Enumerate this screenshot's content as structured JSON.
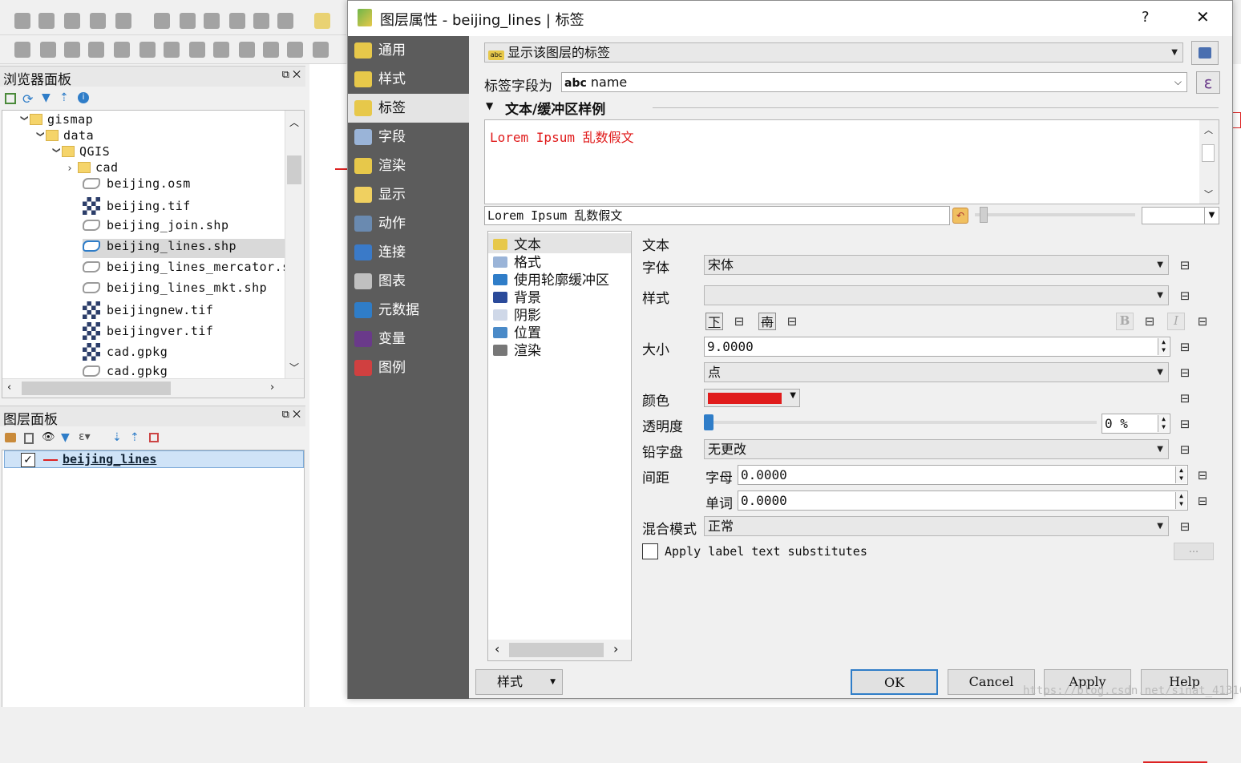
{
  "toolbar": {
    "rows": 2
  },
  "browser_panel": {
    "title": "浏览器面板",
    "items": [
      {
        "label": "gismap",
        "kind": "folder",
        "depth": 0,
        "expanded": true
      },
      {
        "label": "data",
        "kind": "folder",
        "depth": 1,
        "expanded": true
      },
      {
        "label": "QGIS",
        "kind": "folder",
        "depth": 2,
        "expanded": true
      },
      {
        "label": "cad",
        "kind": "folder",
        "depth": 3,
        "expanded": false
      },
      {
        "label": "beijing.osm",
        "kind": "vector"
      },
      {
        "label": "beijing.tif",
        "kind": "raster"
      },
      {
        "label": "beijing_join.shp",
        "kind": "vector"
      },
      {
        "label": "beijing_lines.shp",
        "kind": "vector",
        "selected": true
      },
      {
        "label": "beijing_lines_mercator.sh",
        "kind": "vector"
      },
      {
        "label": "beijing_lines_mkt.shp",
        "kind": "vector"
      },
      {
        "label": "beijingnew.tif",
        "kind": "raster"
      },
      {
        "label": "beijingver.tif",
        "kind": "raster"
      },
      {
        "label": "cad.gpkg",
        "kind": "raster"
      },
      {
        "label": "cad.gpkg",
        "kind": "vector"
      }
    ]
  },
  "layers_panel": {
    "title": "图层面板",
    "layer": "beijing_lines",
    "checked": true
  },
  "dialog": {
    "title": "图层属性 - beijing_lines | 标签",
    "help": "?",
    "close": "✕",
    "sidebar": [
      "通用",
      "样式",
      "标签",
      "字段",
      "渲染",
      "显示",
      "动作",
      "连接",
      "图表",
      "元数据",
      "变量",
      "图例"
    ],
    "sidebar_selected": 2,
    "mode_combo": "显示该图层的标签",
    "label_field_label": "标签字段为",
    "label_field_value": "name",
    "expr_symbol": "ε",
    "sample_section": "文本/缓冲区样例",
    "sample_text": "Lorem Ipsum 乱数假文",
    "sample_input": "Lorem Ipsum 乱数假文",
    "sub_tabs": [
      "文本",
      "格式",
      "使用轮廓缓冲区",
      "背景",
      "阴影",
      "位置",
      "渲染"
    ],
    "text_section": "文本",
    "font_label": "字体",
    "font_value": "宋体",
    "style_label": "样式",
    "style_value": "",
    "underline": "下",
    "strike": "南",
    "bold": "B",
    "italic": "I",
    "size_label": "大小",
    "size_value": "9.0000",
    "unit_value": "点",
    "color_label": "颜色",
    "color_hex": "#e01b1b",
    "transparency_label": "透明度",
    "transparency_value": "0 %",
    "transparency_fraction": 0,
    "case_label": "铅字盘",
    "case_value": "无更改",
    "spacing_label": "间距",
    "letter_label": "字母",
    "letter_value": "0.0000",
    "word_label": "单词",
    "word_value": "0.0000",
    "blend_label": "混合模式",
    "blend_value": "正常",
    "substitute_label": "Apply label text substitutes",
    "ellipsis": "...",
    "style_button": "样式",
    "ok": "OK",
    "cancel": "Cancel",
    "apply": "Apply",
    "help_button": "Help"
  },
  "watermark": "https://blog.csdn.net/sinat_41310868"
}
